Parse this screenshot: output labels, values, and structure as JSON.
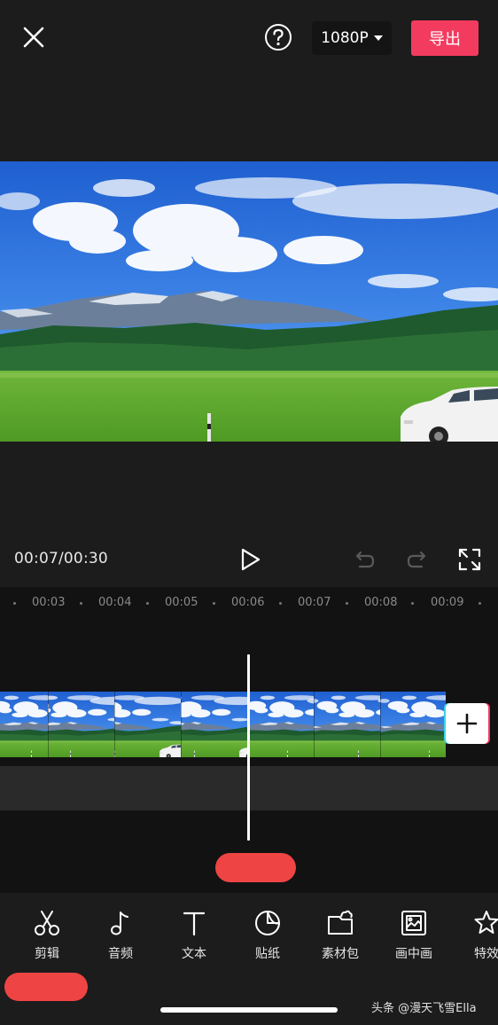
{
  "top_bar": {
    "close_icon": "close-icon",
    "help_icon": "question-circle-icon",
    "resolution": "1080P",
    "export_label": "导出"
  },
  "colors": {
    "background": "#1c1c1c",
    "accent": "#f23b5f",
    "timeline_bg": "#121212",
    "redaction": "#ef4444"
  },
  "player": {
    "time": "00:07/00:30",
    "current_time": "00:07",
    "total_time": "00:30",
    "play_icon": "play-icon",
    "undo_icon": "undo-icon",
    "redo_icon": "redo-icon",
    "fullscreen_icon": "fullscreen-icon"
  },
  "timeline": {
    "ticks": [
      "00:03",
      "00:04",
      "00:05",
      "00:06",
      "00:07",
      "00:08",
      "00:09"
    ],
    "add_clip_icon": "plus-icon"
  },
  "toolbar": {
    "items": [
      {
        "label": "剪辑",
        "icon": "scissors-icon"
      },
      {
        "label": "音频",
        "icon": "music-note-icon"
      },
      {
        "label": "文本",
        "icon": "text-icon"
      },
      {
        "label": "贴纸",
        "icon": "sticker-icon"
      },
      {
        "label": "素材包",
        "icon": "material-pack-icon"
      },
      {
        "label": "画中画",
        "icon": "picture-in-picture-icon"
      },
      {
        "label": "特效",
        "icon": "star-effects-icon"
      }
    ]
  },
  "watermark": "头条 @漫天飞雪Ella"
}
